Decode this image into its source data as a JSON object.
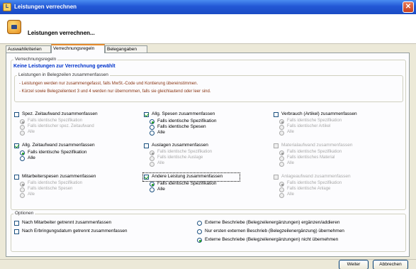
{
  "window": {
    "title": "Leistungen verrechnen",
    "close_glyph": "✕",
    "icon": "app-icon"
  },
  "header": {
    "title": "Leistungen verrechnen..."
  },
  "tabs": [
    {
      "label": "Auswahlkriterien"
    },
    {
      "label": "Verrechnungsregeln"
    },
    {
      "label": "Belegangaben"
    }
  ],
  "rules": {
    "group_label": "Verrechnungsregeln",
    "warning": "Keine Leistungen zur Verrechnung gewählt",
    "belegzeilen_label": "Leistungen in Belegzeilen zusammenfassen",
    "notes": [
      "- Leistungen werden nur zusammengefasst, falls MwSt.-Code und Kontierung übereinstimmen.",
      "- Kürzel sowie Belegzeilentext 3 und 4 werden nur übernommen, falls sie gleichlautend oder leer sind."
    ],
    "blocks": [
      {
        "label": "Spez. Zeitaufwand zusammenfassen",
        "checked": false,
        "disabled": false,
        "sub_disabled": true,
        "selected": 0,
        "options": [
          "Falls identische Spezifikation",
          "Falls identischer spez. Zeitaufwand",
          "Alle"
        ]
      },
      {
        "label": "Allg. Spesen zusammenfassen",
        "checked": true,
        "disabled": false,
        "sub_disabled": false,
        "selected": 0,
        "options": [
          "Falls identische Spezifikation",
          "Falls identische Spesen",
          "Alle"
        ]
      },
      {
        "label": "Verbrauch (Artikel) zusammenfassen",
        "checked": false,
        "disabled": false,
        "sub_disabled": true,
        "selected": 0,
        "options": [
          "Falls identische Spezifikation",
          "Falls identischer Artikel",
          "Alle"
        ]
      },
      {
        "label": "Allg. Zeitaufwand zusammenfassen",
        "checked": true,
        "disabled": false,
        "sub_disabled": false,
        "selected": 0,
        "options": [
          "Falls identische Spezifikation",
          "Alle"
        ]
      },
      {
        "label": "Auslagen zusammenfassen",
        "checked": false,
        "disabled": false,
        "sub_disabled": true,
        "selected": 0,
        "options": [
          "Falls identische Spezifikation",
          "Falls identische Auslage",
          "Alle"
        ]
      },
      {
        "label": "Materialaufwand zusammenfassen",
        "checked": false,
        "disabled": true,
        "sub_disabled": true,
        "selected": 0,
        "options": [
          "Falls identische Spezifikation",
          "Falls identisches Material",
          "Alle"
        ]
      },
      {
        "label": "Mitarbeiterspesen zusammenfassen",
        "checked": false,
        "disabled": false,
        "sub_disabled": true,
        "selected": 0,
        "options": [
          "Falls identische Spezifikation",
          "Falls identische Spesen",
          "Alle"
        ]
      },
      {
        "label": "Andere Leistung zusammenfassen",
        "checked": true,
        "disabled": false,
        "sub_disabled": false,
        "selected": 0,
        "focused": true,
        "options": [
          "Falls identische Spezifikation",
          "Alle"
        ]
      },
      {
        "label": "Anlageaufwand zusammenfassen",
        "checked": false,
        "disabled": true,
        "sub_disabled": true,
        "selected": 0,
        "options": [
          "Falls identische Spezifikation",
          "Falls identische Anlage",
          "Alle"
        ]
      }
    ]
  },
  "optionen": {
    "group_label": "Optionen",
    "checks": [
      {
        "label": "Nach Mitarbeiter getrennt zusammenfassen",
        "checked": false
      },
      {
        "label": "Nach Erbringungsdatum getrennt zusammenfassen",
        "checked": false
      }
    ],
    "radios": [
      {
        "label": "Externe Beschriebe (Belegzeilenergänzungen) ergänzen/addieren",
        "checked": false
      },
      {
        "label": "Nur ersten externen Beschrieb (Belegzeilenergänzung) übernehmen",
        "checked": false
      },
      {
        "label": "Externe Beschriebe (Belegzeilenergänzungen) nicht übernehmen",
        "checked": true
      }
    ]
  },
  "buttons": {
    "weiter": "Weiter",
    "abbrechen": "Abbrechen"
  },
  "colors": {
    "titlebar": "#2257d5",
    "warning": "#0033cc",
    "note": "#883311",
    "check": "#21a121"
  }
}
